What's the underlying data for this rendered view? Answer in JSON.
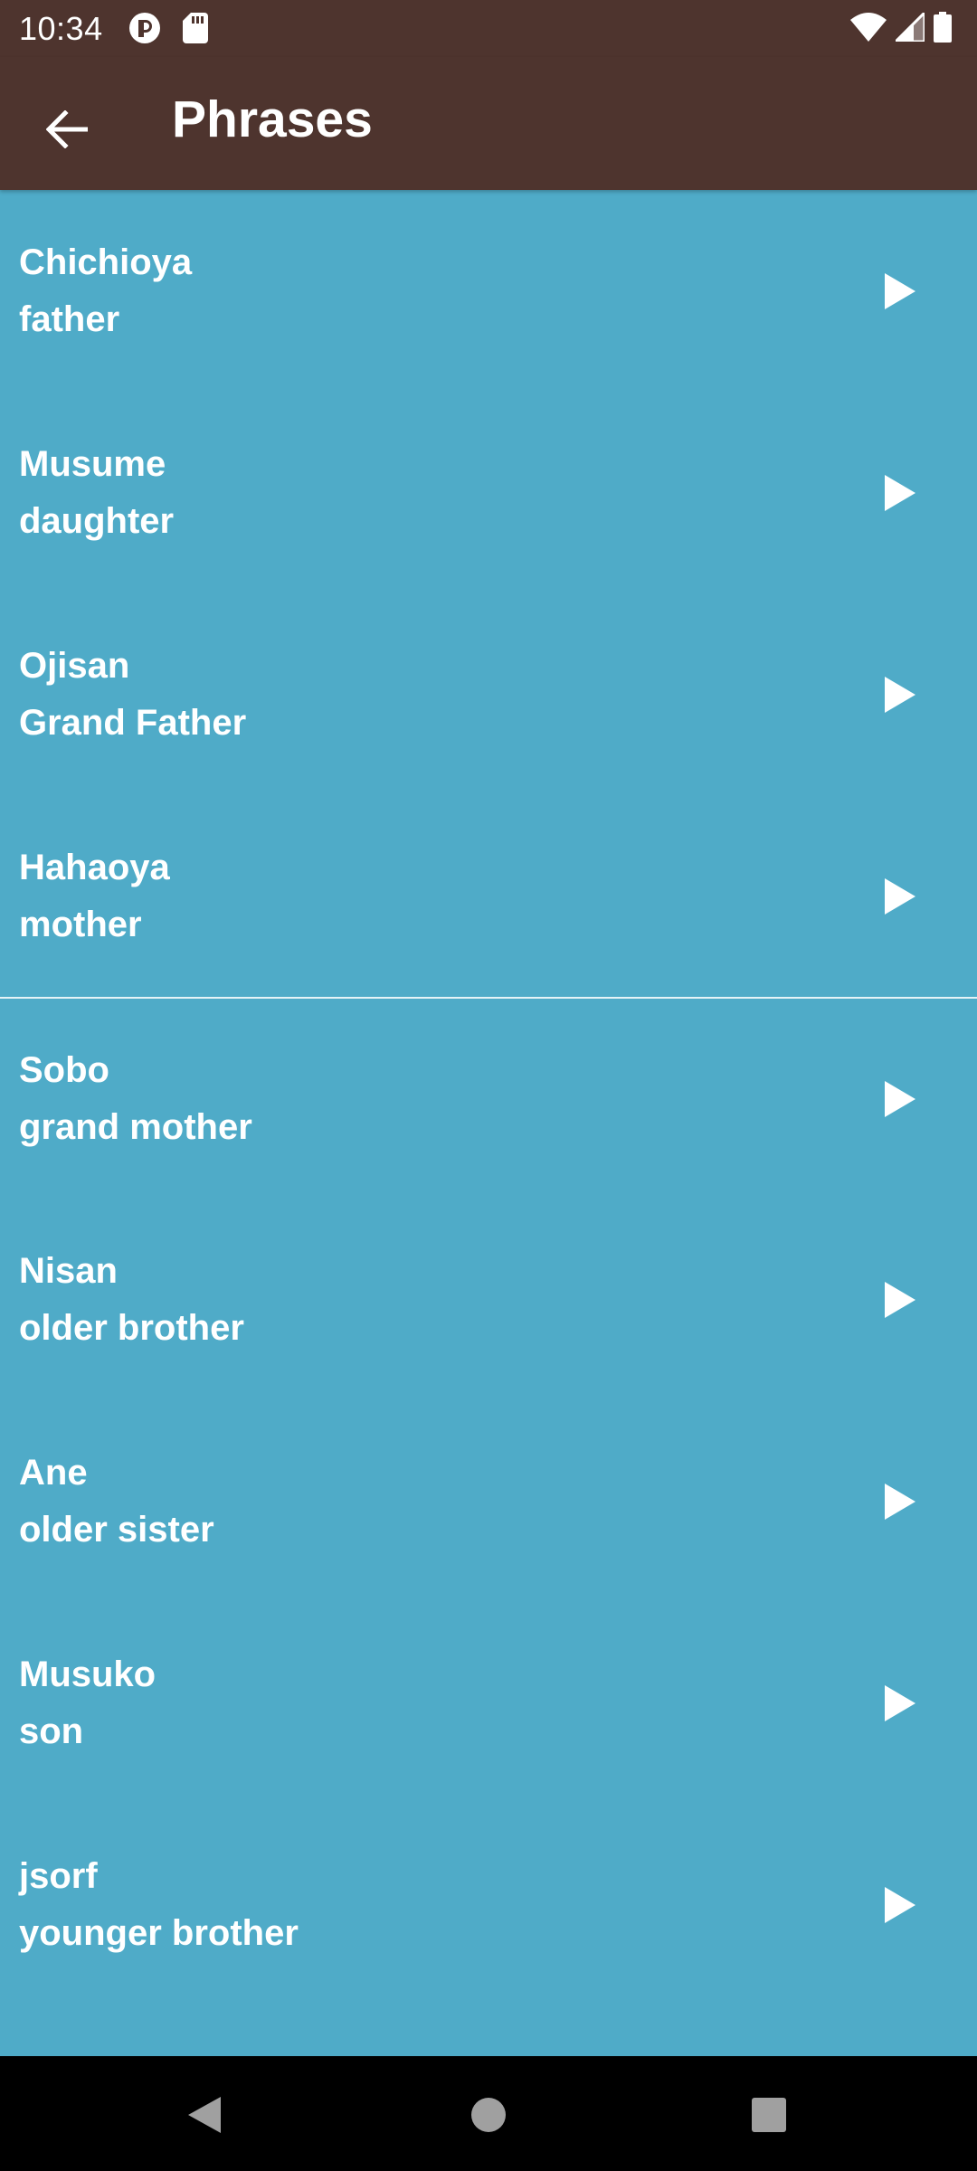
{
  "status_bar": {
    "time": "10:34",
    "left_icons": [
      "notification-icon",
      "sd-card-icon"
    ],
    "right_icons": [
      "wifi-icon",
      "signal-icon",
      "battery-icon"
    ]
  },
  "app_bar": {
    "back_icon": "arrow-back-icon",
    "title": "Phrases",
    "background_color": "#4e342e"
  },
  "list": {
    "background_color": "#4fabc8",
    "play_icon": "play-icon",
    "items": [
      {
        "japanese": "Chichioya",
        "english": "father"
      },
      {
        "japanese": "Musume",
        "english": "daughter"
      },
      {
        "japanese": "Ojisan",
        "english": "Grand Father"
      },
      {
        "japanese": "Hahaoya",
        "english": "mother"
      },
      {
        "japanese": "Sobo",
        "english": "grand mother"
      },
      {
        "japanese": "Nisan",
        "english": "older brother"
      },
      {
        "japanese": "Ane",
        "english": "older sister"
      },
      {
        "japanese": "Musuko",
        "english": "son"
      },
      {
        "japanese": "jsorf",
        "english": "younger brother"
      }
    ]
  },
  "nav_bar": {
    "buttons": [
      "back-nav-icon",
      "home-nav-icon",
      "recents-nav-icon"
    ]
  }
}
